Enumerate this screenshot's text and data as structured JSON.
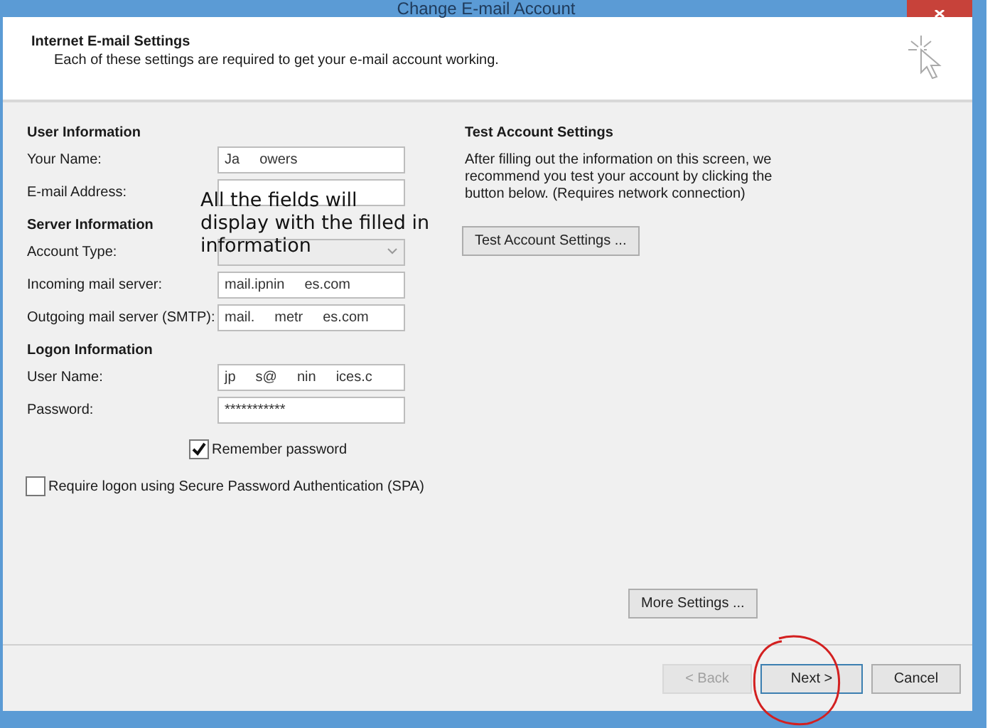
{
  "window": {
    "title": "Change E-mail Account"
  },
  "header": {
    "title": "Internet E-mail Settings",
    "subtitle": "Each of these settings are required to get your e-mail account working."
  },
  "sections": [
    {
      "heading": "User Information",
      "fields": [
        {
          "label": "Your Name:",
          "kind": "text",
          "parts": [
            "Ja",
            "owers"
          ],
          "disabled": false
        },
        {
          "label": "E-mail Address:",
          "kind": "text",
          "disabled": false
        }
      ]
    },
    {
      "heading": "Server Information",
      "fields": [
        {
          "label": "Account Type:",
          "kind": "select",
          "disabled": true
        },
        {
          "label": "Incoming mail server:",
          "kind": "text",
          "parts": [
            "mail.ipnin",
            "es.com"
          ],
          "disabled": false
        },
        {
          "label": "Outgoing mail server (SMTP):",
          "kind": "text",
          "parts": [
            "mail.",
            "metr",
            "es.com"
          ],
          "disabled": false
        }
      ]
    },
    {
      "heading": "Logon Information",
      "fields": [
        {
          "label": "User Name:",
          "kind": "text",
          "parts": [
            "jp",
            "s@",
            "nin",
            "ices.c"
          ],
          "disabled": false
        },
        {
          "label": "Password:",
          "kind": "text",
          "parts": [
            "***********"
          ],
          "disabled": false
        }
      ]
    }
  ],
  "remember": {
    "label": "Remember password",
    "checked": true
  },
  "spa": {
    "label": "Require logon using Secure Password Authentication (SPA)",
    "checked": false
  },
  "test": {
    "heading": "Test Account Settings",
    "text": "After filling out the information on this screen, we recommend you test your account by clicking the button below. (Requires network connection)",
    "button": "Test Account Settings ..."
  },
  "more_settings": "More Settings ...",
  "buttons": [
    {
      "label": "< Back",
      "disabled": true
    },
    {
      "label": "Next >",
      "disabled": false
    },
    {
      "label": "Cancel",
      "disabled": false
    }
  ],
  "annotation": {
    "lines": [
      "All the fields will",
      "display with the filled in",
      "information"
    ]
  }
}
